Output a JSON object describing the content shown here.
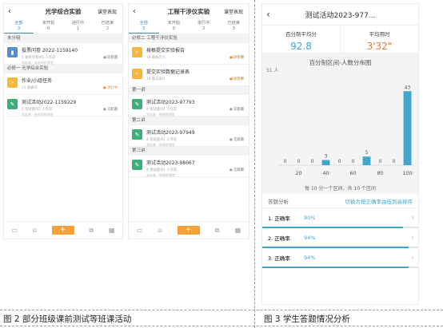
{
  "left_phone": {
    "title": "光学综合实验",
    "action": "课堂表现",
    "tabs": [
      {
        "label": "全部",
        "count": "3"
      },
      {
        "label": "未开始",
        "count": "0"
      },
      {
        "label": "进行中",
        "count": "1"
      },
      {
        "label": "已结束",
        "count": "2"
      }
    ],
    "groups": [
      {
        "label": "未分组",
        "items": [
          {
            "name": "投票问卷 2022-1159140",
            "meta1": "4 调查问卷/61 人作答",
            "meta2": "18 答题",
            "status": "已结束",
            "owner": "发起者 · 张老师的课堂"
          }
        ]
      },
      {
        "label": "必修一 光学综合实验",
        "items": [
          {
            "name": "作业/小组任务",
            "meta1": "11 图表/6",
            "meta2": "",
            "status": "进行中",
            "owner": ""
          },
          {
            "name": "测试活动2022-1159229",
            "meta1": "4 测试题/61 人作答",
            "meta2": "18 题",
            "status": "已结束",
            "owner": "发起者 · 张老师的课堂"
          }
        ]
      }
    ]
  },
  "mid_phone": {
    "title": "工程干涉仪实验",
    "action": "课堂表现",
    "tabs": [
      {
        "label": "全部",
        "count": "5"
      },
      {
        "label": "未开始",
        "count": "0"
      },
      {
        "label": "进行中",
        "count": "2"
      },
      {
        "label": "已结束",
        "count": "3"
      }
    ],
    "groups": [
      {
        "label": "必修二 工程干涉仪实验",
        "items": [
          {
            "name": "按根提交实验报告",
            "meta1": "18 篇报告/1",
            "meta2": "33 答题",
            "status": "进行中",
            "owner": ""
          },
          {
            "name": "提交实验数据记录表",
            "meta1": "18 篇记录/1",
            "meta2": "21 答题",
            "status": "进行中",
            "owner": ""
          }
        ]
      },
      {
        "label": "第一讲",
        "items": [
          {
            "name": "测试活动2023-97793",
            "meta1": "4 测试题/61 人作答",
            "meta2": "3 答题",
            "status": "已结束",
            "owner": "发起者 · 陈德明课堂"
          }
        ]
      },
      {
        "label": "第二讲",
        "items": [
          {
            "name": "测试活动2023-97949",
            "meta1": "4 测试题/61 人作答",
            "meta2": "3 答题",
            "status": "已结束",
            "owner": "发起者 · 陈德明课堂"
          }
        ]
      },
      {
        "label": "第三讲",
        "items": [
          {
            "name": "测试活动2023-98067",
            "meta1": "4 测试题/61 人作答",
            "meta2": "3 答题",
            "status": "已结束",
            "owner": "发起者 · 陈德明课堂"
          }
        ]
      }
    ]
  },
  "right_phone": {
    "title": "测试活动2023-977...",
    "stats": [
      {
        "label": "百分制平均分",
        "value": "92.8",
        "color": "#3fa6cc"
      },
      {
        "label": "平均用时",
        "value": "3'32\"",
        "color": "#e07a3c"
      }
    ],
    "chart_title": "百分制区间-人数分布图",
    "y_label": "51 人",
    "note": "每 10 分一个区间，共 10 个区间",
    "section_label": "答题分析",
    "section_action": "切换为按正确率由低到高排序",
    "rows": [
      {
        "label": "1. 正确率",
        "pct": "90%",
        "frac": 0.9
      },
      {
        "label": "2. 正确率",
        "pct": "94%",
        "frac": 0.94
      },
      {
        "label": "3. 正确率",
        "pct": "94%",
        "frac": 0.94
      }
    ]
  },
  "chart_data": {
    "type": "bar",
    "title": "百分制区间-人数分布图",
    "ylabel": "51 人",
    "x_ticks": [
      "20",
      "40",
      "60",
      "80",
      "100"
    ],
    "values": [
      0,
      0,
      0,
      3,
      0,
      0,
      5,
      0,
      0,
      43
    ],
    "ylim": [
      0,
      51
    ],
    "color": "#3fa6cc"
  },
  "captions": {
    "left": "图 2  部分班级课前测试等班课活动",
    "right": "图 3  学生答题情况分析"
  }
}
